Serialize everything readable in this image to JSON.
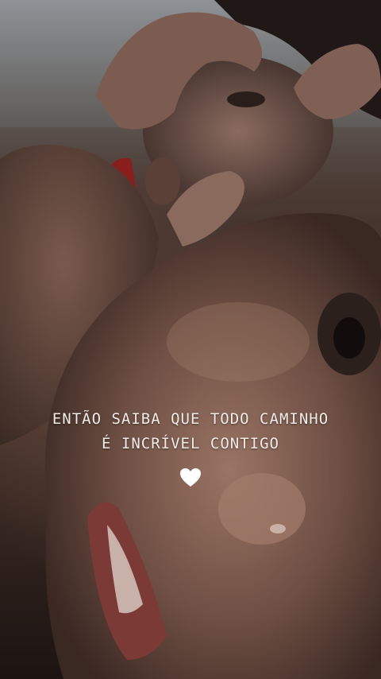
{
  "story": {
    "caption_line1": "ENTÃO SAIBA QUE TODO CAMINHO",
    "caption_line2": "É INCRÍVEL CONTIGO",
    "heart_icon": "white-heart-icon",
    "colors": {
      "text": "#f1ece8",
      "heart": "#ffffff"
    }
  }
}
